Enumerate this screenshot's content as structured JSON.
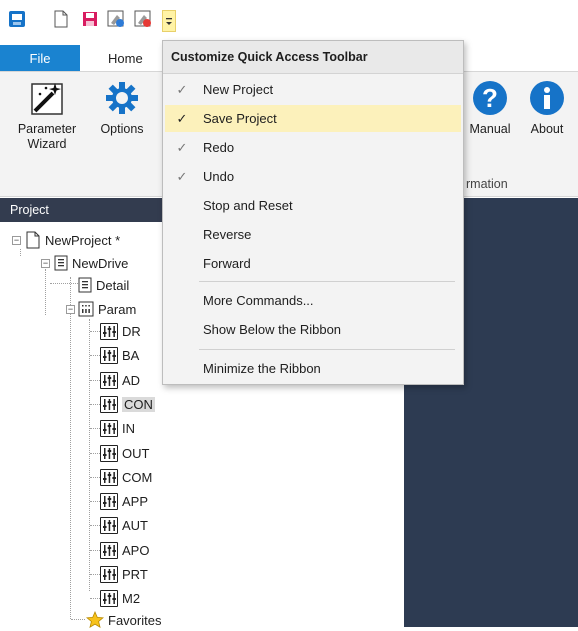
{
  "ribbon_tabs": {
    "file": "File",
    "home": "Home"
  },
  "ribbon_buttons": {
    "parameter_wizard_line1": "Parameter",
    "parameter_wizard_line2": "Wizard",
    "options": "Options",
    "manual": "Manual",
    "about": "About",
    "information_group_partial": "rmation"
  },
  "project_panel": {
    "header": "Project",
    "tree": {
      "project": "NewProject *",
      "drive": "NewDrive",
      "detail": "Detail",
      "parameters": "Param",
      "items": [
        "DR",
        "BA",
        "AD",
        "CON",
        "IN",
        "OUT",
        "COM",
        "APP",
        "AUT",
        "APO",
        "PRT",
        "M2"
      ],
      "selected_item": "CON",
      "favorites": "Favorites"
    }
  },
  "menu": {
    "title": "Customize Quick Access Toolbar",
    "items": [
      {
        "label": "New Project",
        "checked": true
      },
      {
        "label": "Save Project",
        "checked": true,
        "highlighted": true
      },
      {
        "label": "Redo",
        "checked": true
      },
      {
        "label": "Undo",
        "checked": true
      },
      {
        "label": "Stop and Reset",
        "checked": false
      },
      {
        "label": "Reverse",
        "checked": false
      },
      {
        "label": "Forward",
        "checked": false
      }
    ],
    "more_commands": "More Commands...",
    "show_below": "Show Below the Ribbon",
    "minimize": "Minimize the Ribbon",
    "check_glyph": "✓"
  },
  "colors": {
    "file_tab": "#1a83d0",
    "panel_header": "#333c4f",
    "dark_area": "#2d3b52",
    "menu_highlight": "#fcf1bb",
    "icon_blue": "#1673c8"
  }
}
